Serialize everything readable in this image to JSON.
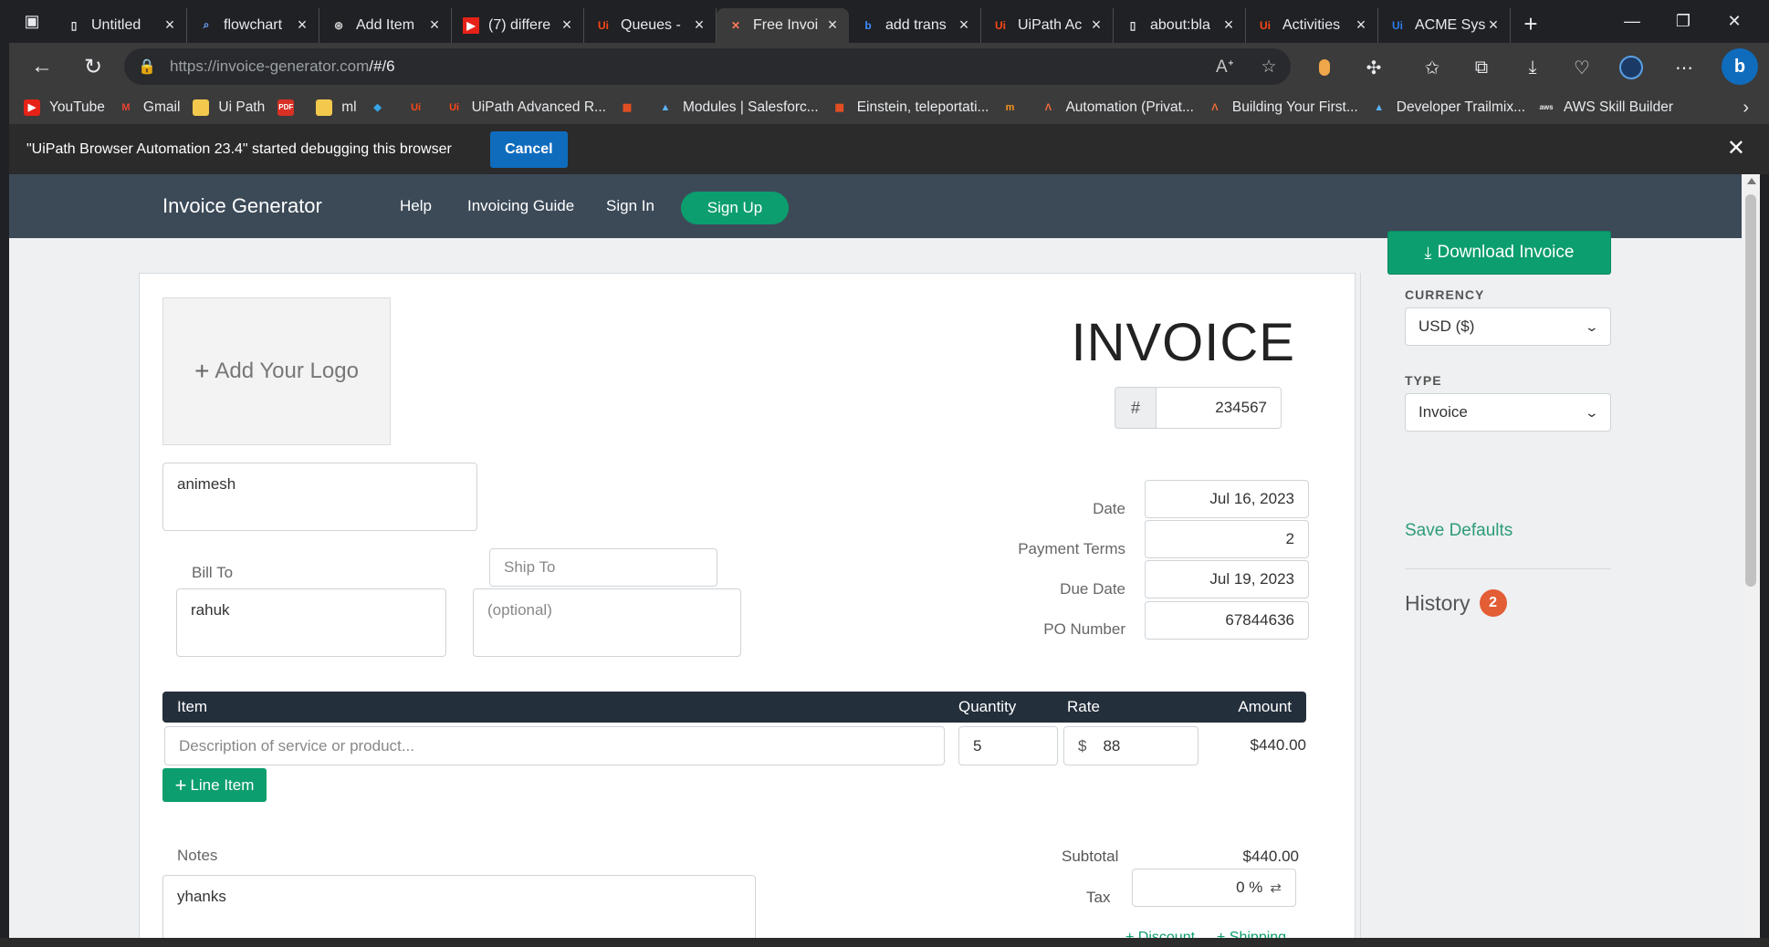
{
  "browser": {
    "tabs": [
      {
        "label": "Untitled",
        "icon": "page-icon"
      },
      {
        "label": "flowchart",
        "icon": "search-icon"
      },
      {
        "label": "Add Item",
        "icon": "openai-icon"
      },
      {
        "label": "(7) differe",
        "icon": "youtube-icon"
      },
      {
        "label": "Queues -",
        "icon": "uipath-icon"
      },
      {
        "label": "Free Invoi",
        "icon": "invoice-generator-icon"
      },
      {
        "label": "add trans",
        "icon": "bing-icon"
      },
      {
        "label": "UiPath Ac",
        "icon": "uipath-icon"
      },
      {
        "label": "about:bla",
        "icon": "page-icon"
      },
      {
        "label": "Activities",
        "icon": "uipath-icon"
      },
      {
        "label": "ACME Sys",
        "icon": "uipath-blue-icon"
      }
    ],
    "active_tab": 5,
    "url_host": "https://invoice-generator.com",
    "url_path": "/#/6",
    "bookmarks": [
      {
        "label": "YouTube",
        "icon": "youtube-icon"
      },
      {
        "label": "Gmail",
        "icon": "gmail-icon"
      },
      {
        "label": "Ui Path",
        "icon": "folder-icon"
      },
      {
        "label": "",
        "icon": "pdf-icon"
      },
      {
        "label": "ml",
        "icon": "folder-icon"
      },
      {
        "label": "",
        "icon": "diamond-icon"
      },
      {
        "label": "",
        "icon": "uipath-icon"
      },
      {
        "label": "UiPath Advanced R...",
        "icon": "uipath-icon"
      },
      {
        "label": "",
        "icon": "microsoft-icon"
      },
      {
        "label": "Modules | Salesforc...",
        "icon": "trailhead-icon"
      },
      {
        "label": "Einstein, teleportati...",
        "icon": "microsoft-icon"
      },
      {
        "label": "",
        "icon": "mindmajix-icon"
      },
      {
        "label": "Automation (Privat...",
        "icon": "automation-icon"
      },
      {
        "label": "Building Your First...",
        "icon": "automation-icon"
      },
      {
        "label": "Developer Trailmix...",
        "icon": "trailhead-icon"
      },
      {
        "label": "AWS Skill Builder",
        "icon": "aws-icon"
      }
    ]
  },
  "debug": {
    "message": "\"UiPath Browser Automation 23.4\" started debugging this browser",
    "cancel_label": "Cancel"
  },
  "site": {
    "brand": "Invoice Generator",
    "nav": [
      "Help",
      "Invoicing Guide",
      "Sign In"
    ],
    "signup_label": "Sign Up"
  },
  "invoice": {
    "logo_label": "Add Your Logo",
    "title": "INVOICE",
    "number_prefix": "#",
    "number": "234567",
    "from": "animesh",
    "bill_to_label": "Bill To",
    "bill_to": "rahuk",
    "ship_to_label": "Ship To",
    "ship_to_placeholder": "(optional)",
    "date_label": "Date",
    "date": "Jul 16, 2023",
    "payment_terms_label": "Payment Terms",
    "payment_terms": "2",
    "due_date_label": "Due Date",
    "due_date": "Jul 19, 2023",
    "po_label": "PO Number",
    "po_number": "67844636",
    "table": {
      "headers": {
        "item": "Item",
        "quantity": "Quantity",
        "rate": "Rate",
        "amount": "Amount"
      },
      "rows": [
        {
          "description_placeholder": "Description of service or product...",
          "quantity": "5",
          "currency_symbol": "$",
          "rate": "88",
          "amount": "$440.00"
        }
      ]
    },
    "line_item_label": "Line Item",
    "notes_label": "Notes",
    "notes": "yhanks",
    "subtotal_label": "Subtotal",
    "subtotal": "$440.00",
    "tax_label": "Tax",
    "tax": "0 %",
    "discount_label": "+ Discount",
    "shipping_label": "+ Shipping"
  },
  "sidebar": {
    "download_label": "Download Invoice",
    "currency_label": "CURRENCY",
    "currency_value": "USD ($)",
    "type_label": "TYPE",
    "type_value": "Invoice",
    "save_defaults": "Save Defaults",
    "history_label": "History",
    "history_count": "2"
  },
  "colors": {
    "brand_green": "#0c9e6e",
    "nav_bg": "#3c4a58",
    "table_head_bg": "#232f3b",
    "badge_orange": "#e35d35",
    "edge_blue": "#0f6cbd"
  }
}
